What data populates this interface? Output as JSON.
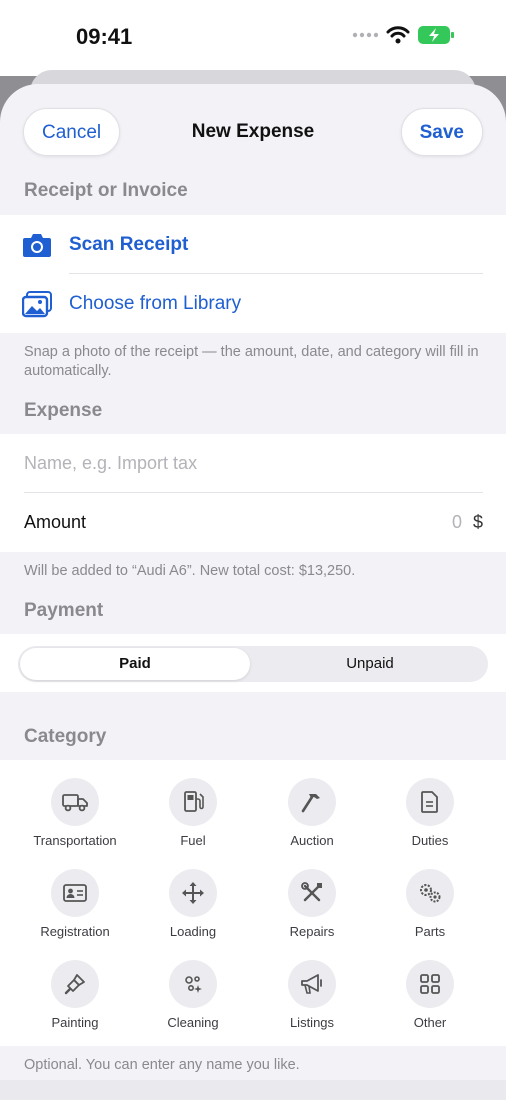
{
  "status": {
    "time": "09:41"
  },
  "nav": {
    "cancel": "Cancel",
    "title": "New Expense",
    "save": "Save"
  },
  "receipt": {
    "header": "Receipt or Invoice",
    "scan": "Scan Receipt",
    "library": "Choose from Library",
    "footnote": "Snap a photo of the receipt — the amount, date, and category will fill in automatically."
  },
  "expense": {
    "header": "Expense",
    "name_placeholder": "Name, e.g. Import tax",
    "amount_label": "Amount",
    "amount_value": "0",
    "currency": "$",
    "footnote": "Will be added to “Audi A6”. New total cost: $13,250."
  },
  "payment": {
    "header": "Payment",
    "options": [
      "Paid",
      "Unpaid"
    ],
    "selected": "Paid"
  },
  "category": {
    "header": "Category",
    "items": [
      {
        "label": "Transportation",
        "icon": "truck-icon"
      },
      {
        "label": "Fuel",
        "icon": "fuel-pump-icon"
      },
      {
        "label": "Auction",
        "icon": "hammer-icon"
      },
      {
        "label": "Duties",
        "icon": "document-icon"
      },
      {
        "label": "Registration",
        "icon": "id-card-icon"
      },
      {
        "label": "Loading",
        "icon": "move-arrows-icon"
      },
      {
        "label": "Repairs",
        "icon": "wrench-screwdriver-icon"
      },
      {
        "label": "Parts",
        "icon": "gears-icon"
      },
      {
        "label": "Painting",
        "icon": "paint-brush-icon"
      },
      {
        "label": "Cleaning",
        "icon": "sparkles-icon"
      },
      {
        "label": "Listings",
        "icon": "megaphone-icon"
      },
      {
        "label": "Other",
        "icon": "grid-icon"
      }
    ],
    "footnote": "Optional. You can enter any name you like."
  },
  "colors": {
    "accent": "#1f5fd1",
    "background": "#f2f2f7",
    "battery": "#34c759"
  }
}
